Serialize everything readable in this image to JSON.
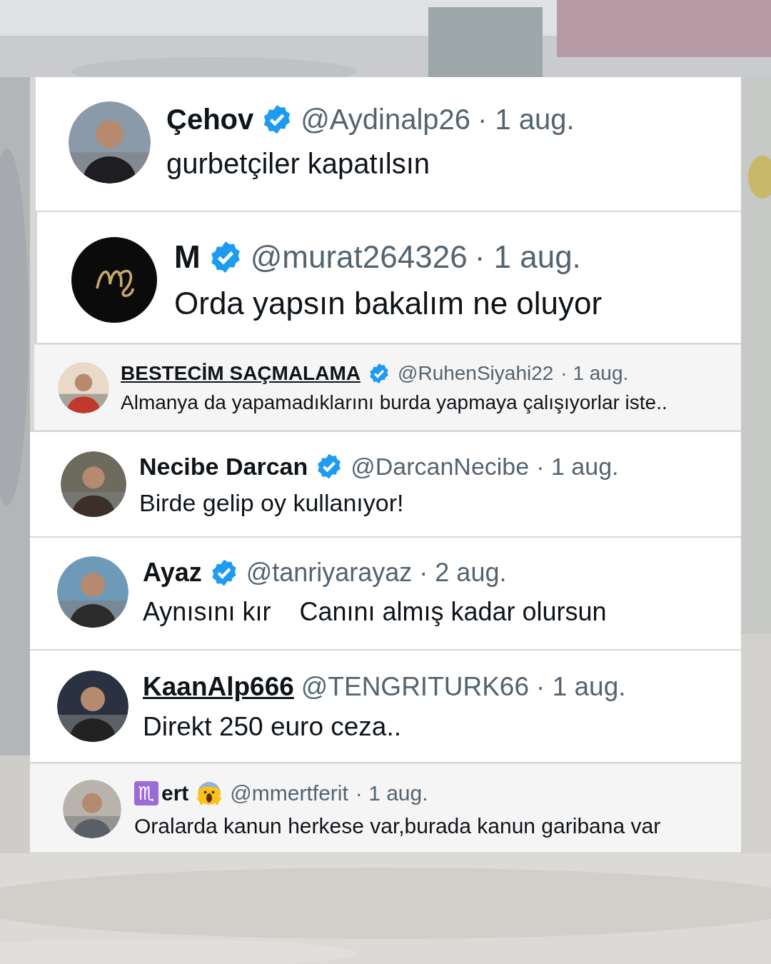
{
  "tweets": [
    {
      "name": "Çehov",
      "verified": true,
      "underlined": false,
      "shaded": false,
      "handle": "@Aydinalp26",
      "date": "· 1 aug.",
      "text": "gurbetçiler kapatılsın"
    },
    {
      "name": "M",
      "verified": true,
      "underlined": false,
      "shaded": false,
      "handle": "@murat264326",
      "date": "· 1 aug.",
      "text": "Orda yapsın bakalım ne oluyor",
      "kind": "logo"
    },
    {
      "name": "BESTECİM SAÇMALAMA",
      "verified": true,
      "underlined": true,
      "shaded": true,
      "handle": "@RuhenSiyahi22",
      "date": "· 1 aug.",
      "text": "Almanya da yapamadıklarını burda yapmaya çalışıyorlar iste.."
    },
    {
      "name": "Necibe Darcan",
      "verified": true,
      "underlined": false,
      "shaded": false,
      "handle": "@DarcanNecibe",
      "date": "· 1 aug.",
      "text": "Birde gelip oy kullanıyor!"
    },
    {
      "name": "Ayaz",
      "verified": true,
      "underlined": false,
      "shaded": false,
      "handle": "@tanriyarayaz",
      "date": "· 2 aug.",
      "text": "Aynısını kır    Canını almış kadar olursun"
    },
    {
      "name": "KaanAlp666",
      "verified": false,
      "underlined": true,
      "shaded": false,
      "handle": "@TENGRITURK66",
      "date": "· 1 aug.",
      "text": "Direkt 250 euro ceza.."
    },
    {
      "name_prefix": "♏",
      "name": "ert",
      "verified": false,
      "underlined": false,
      "shaded": true,
      "handle": "@mmertferit",
      "date": "· 1 aug.",
      "text": "Oralarda kanun herkese var,burada kanun garibana var",
      "emoji": true
    }
  ]
}
